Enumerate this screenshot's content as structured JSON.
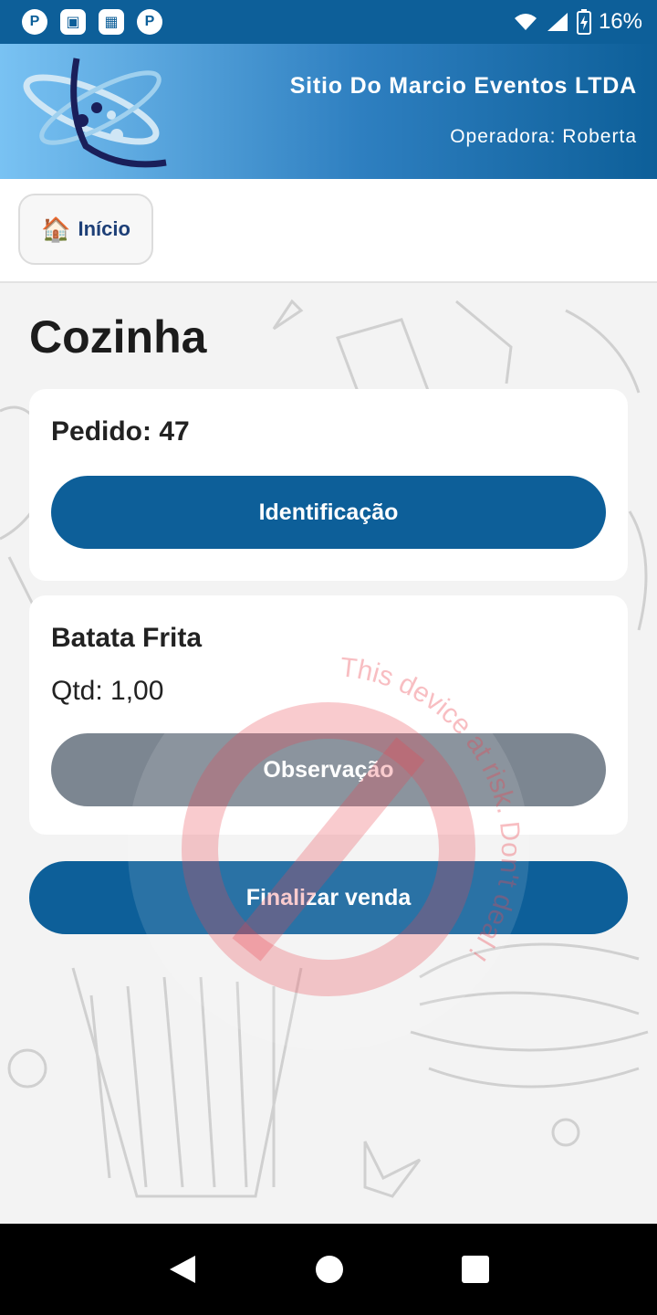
{
  "status_bar": {
    "notification_icons": [
      "app-icon-p",
      "app-icon-square",
      "app-icon-grid",
      "app-icon-p"
    ],
    "battery_percent": "16%"
  },
  "header": {
    "company_name": "Sitio Do Marcio Eventos LTDA",
    "operator": "Operadora: Roberta"
  },
  "nav": {
    "home_icon": "🏠",
    "home_label": "Início"
  },
  "page": {
    "title": "Cozinha"
  },
  "order": {
    "label": "Pedido: 47",
    "identify_button": "Identificação"
  },
  "items": [
    {
      "name": "Batata Frita",
      "quantity": "Qtd: 1,00",
      "observation_button": "Observação"
    }
  ],
  "actions": {
    "finish_sale": "Finalizar venda"
  },
  "watermark": {
    "text": "This device at risk. Don't deal !"
  },
  "colors": {
    "primary": "#0d5f99",
    "secondary_button": "#7c8691",
    "header_gradient_start": "#79c2f3"
  }
}
